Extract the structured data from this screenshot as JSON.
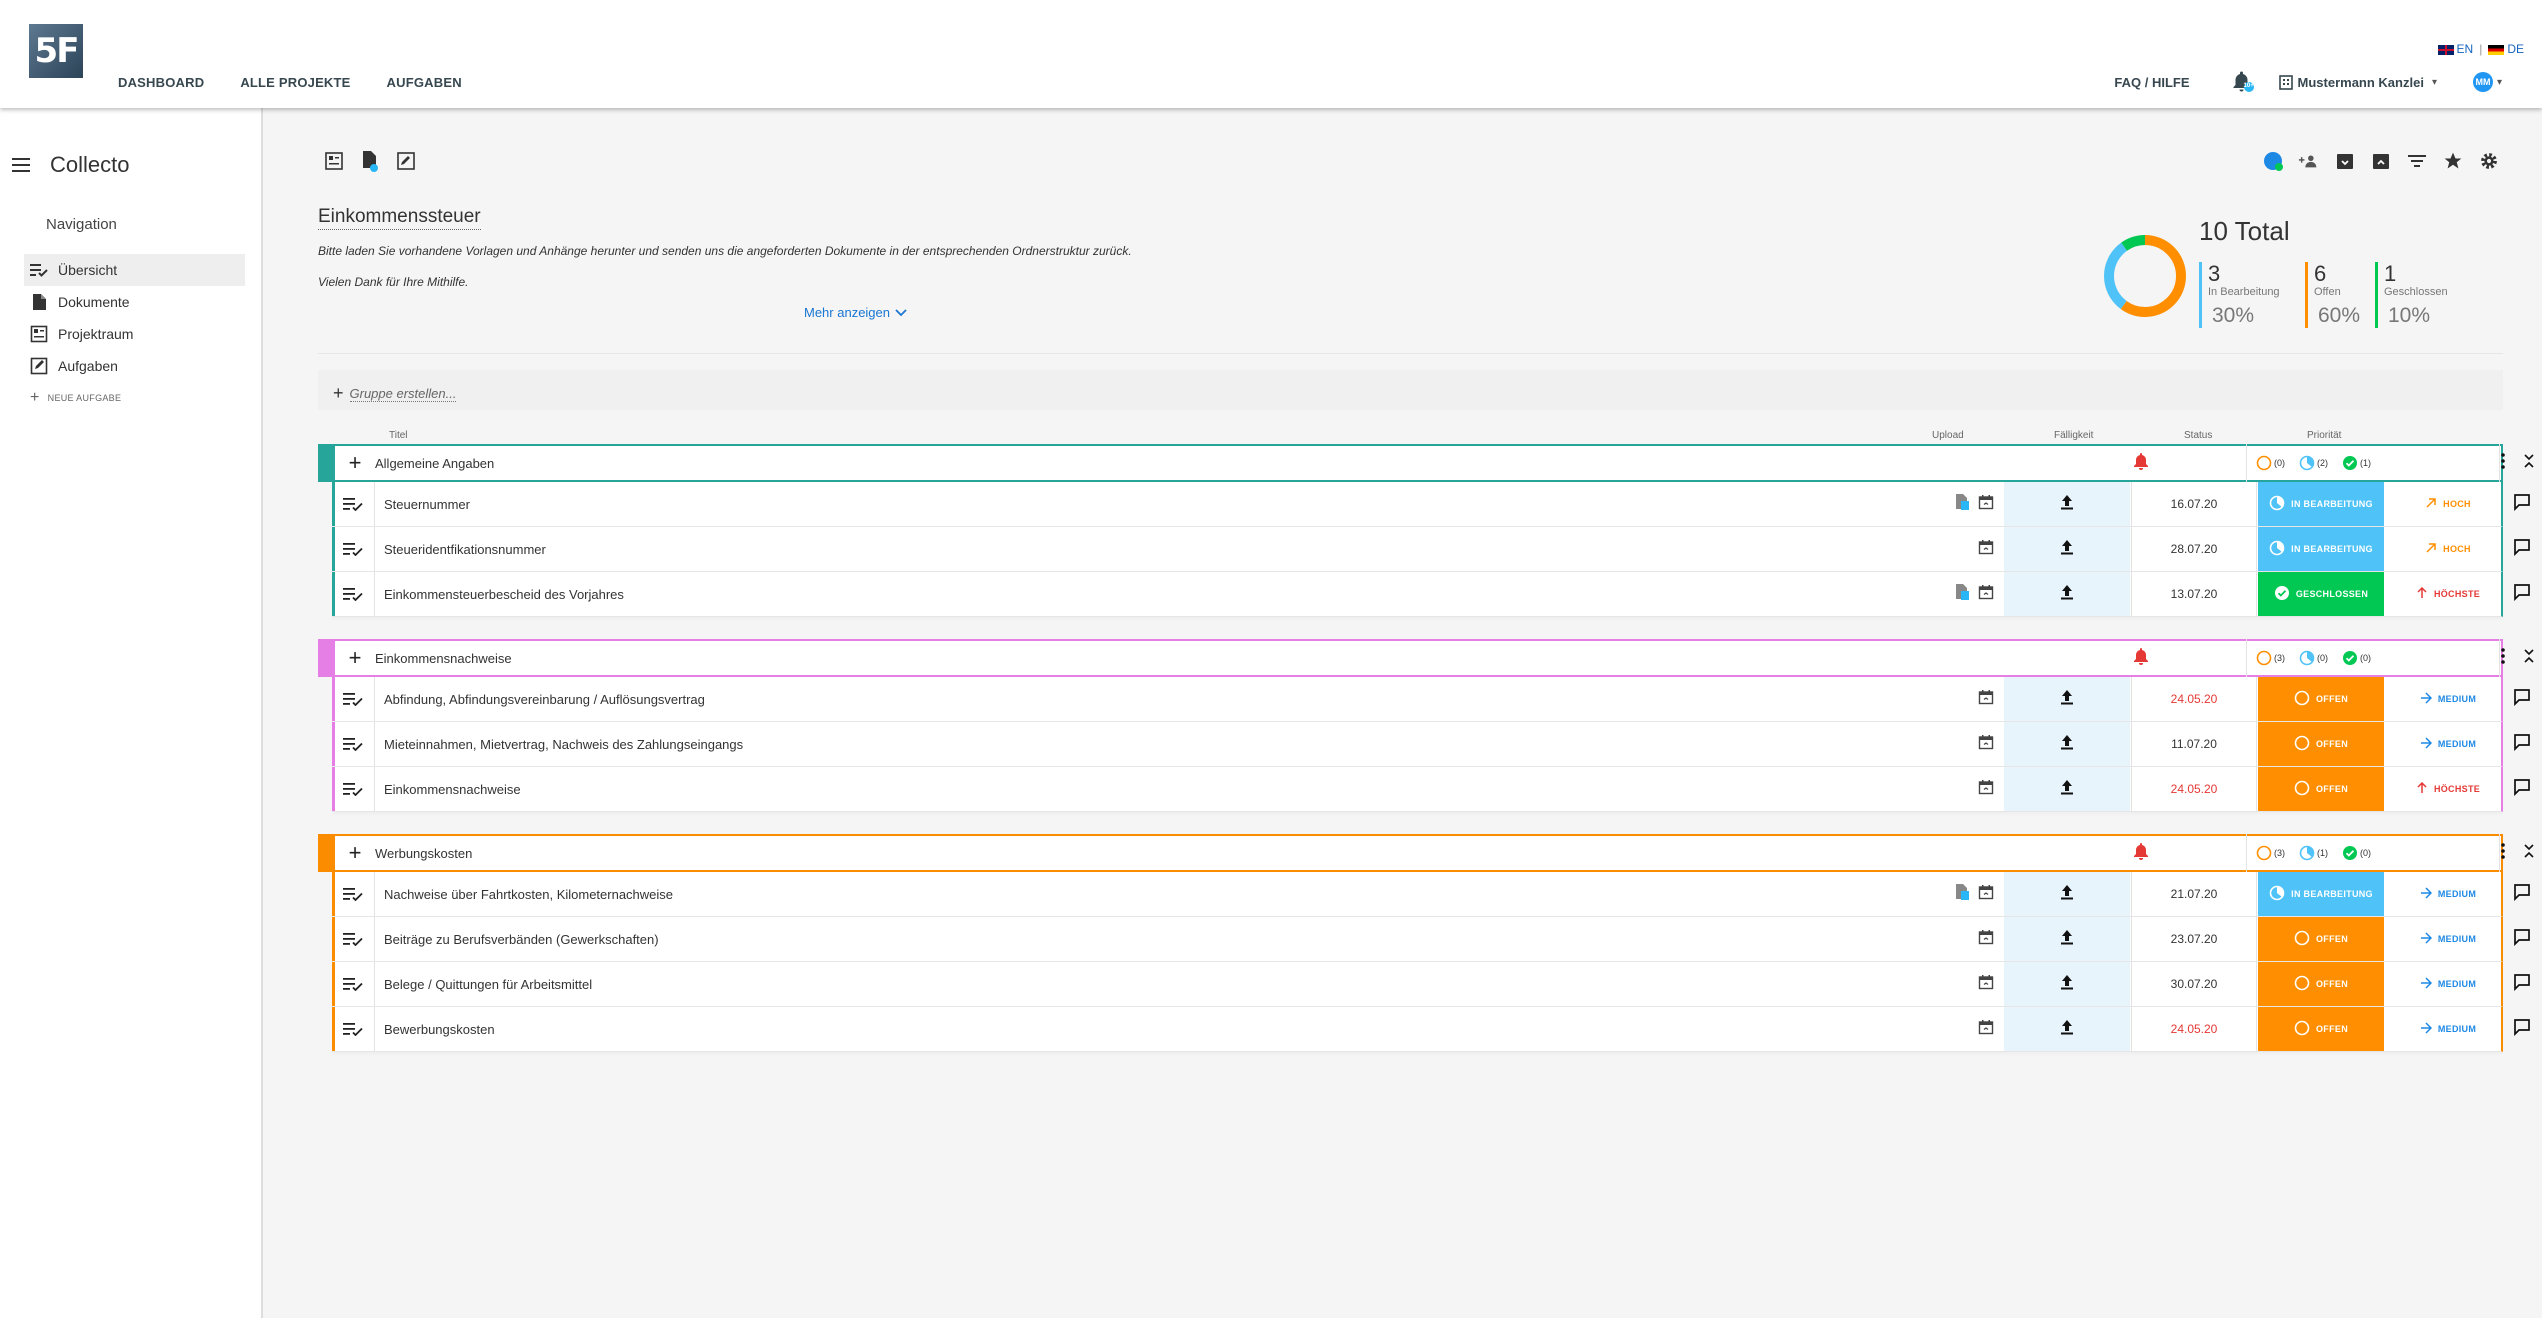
{
  "header": {
    "logo": "5F",
    "nav": [
      "DASHBOARD",
      "ALLE PROJEKTE",
      "AUFGABEN"
    ],
    "lang_en": "EN",
    "lang_de": "DE",
    "faq": "FAQ / HILFE",
    "bell_badge": "10+",
    "org": "Mustermann Kanzlei",
    "avatar": "MM"
  },
  "sidebar": {
    "title": "Collecto",
    "nav_label": "Navigation",
    "items": [
      {
        "label": "Übersicht",
        "icon": "list-check-icon",
        "active": true
      },
      {
        "label": "Dokumente",
        "icon": "document-icon",
        "active": false
      },
      {
        "label": "Projektraum",
        "icon": "projectroom-icon",
        "active": false
      },
      {
        "label": "Aufgaben",
        "icon": "task-edit-icon",
        "active": false
      }
    ],
    "new_task": "NEUE AUFGABE"
  },
  "project": {
    "title": "Einkommenssteuer",
    "description": "Bitte laden Sie vorhandene Vorlagen und Anhänge herunter und senden uns die angeforderten Dokumente in der entsprechenden Ordnerstruktur zurück.",
    "thanks": "Vielen Dank für Ihre Mithilfe.",
    "more": "Mehr anzeigen",
    "create_group": "Gruppe erstellen..."
  },
  "stats": {
    "total": "10 Total",
    "in_progress": {
      "num": "3",
      "label": "In Bearbeitung",
      "pct": "30%",
      "color": "#4fc3f7",
      "fraction": 0.3
    },
    "open": {
      "num": "6",
      "label": "Offen",
      "pct": "60%",
      "color": "#ff8f00",
      "fraction": 0.6
    },
    "closed": {
      "num": "1",
      "label": "Geschlossen",
      "pct": "10%",
      "color": "#00c853",
      "fraction": 0.1
    }
  },
  "columns": {
    "title": "Titel",
    "upload": "Upload",
    "due": "Fälligkeit",
    "status": "Status",
    "priority": "Priorität"
  },
  "groups": [
    {
      "title": "Allgemeine Angaben",
      "color": "#26a69a",
      "counts": {
        "open": "(0)",
        "progress": "(2)",
        "closed": "(1)"
      },
      "rows": [
        {
          "title": "Steuernummer",
          "doc": true,
          "due": "16.07.20",
          "late": false,
          "status": "IN BEARBEITUNG",
          "status_key": "progress",
          "prio": "HOCH",
          "prio_key": "high"
        },
        {
          "title": "Steueridentfikationsnummer",
          "doc": false,
          "due": "28.07.20",
          "late": false,
          "status": "IN BEARBEITUNG",
          "status_key": "progress",
          "prio": "HOCH",
          "prio_key": "high"
        },
        {
          "title": "Einkommensteuerbescheid des Vorjahres",
          "doc": true,
          "due": "13.07.20",
          "late": false,
          "status": "GESCHLOSSEN",
          "status_key": "closed",
          "prio": "HÖCHSTE",
          "prio_key": "highest"
        }
      ]
    },
    {
      "title": "Einkommensnachweise",
      "color": "#e57ee5",
      "counts": {
        "open": "(3)",
        "progress": "(0)",
        "closed": "(0)"
      },
      "rows": [
        {
          "title": "Abfindung, Abfindungsvereinbarung / Auflösungsvertrag",
          "doc": false,
          "due": "24.05.20",
          "late": true,
          "status": "OFFEN",
          "status_key": "open",
          "prio": "MEDIUM",
          "prio_key": "medium"
        },
        {
          "title": "Mieteinnahmen, Mietvertrag, Nachweis des Zahlungseingangs",
          "doc": false,
          "due": "11.07.20",
          "late": false,
          "status": "OFFEN",
          "status_key": "open",
          "prio": "MEDIUM",
          "prio_key": "medium"
        },
        {
          "title": "Einkommensnachweise",
          "doc": false,
          "due": "24.05.20",
          "late": true,
          "status": "OFFEN",
          "status_key": "open",
          "prio": "HÖCHSTE",
          "prio_key": "highest"
        }
      ]
    },
    {
      "title": "Werbungskosten",
      "color": "#fb8c00",
      "counts": {
        "open": "(3)",
        "progress": "(1)",
        "closed": "(0)"
      },
      "rows": [
        {
          "title": "Nachweise über Fahrtkosten, Kilometernachweise",
          "doc": true,
          "due": "21.07.20",
          "late": false,
          "status": "IN BEARBEITUNG",
          "status_key": "progress",
          "prio": "MEDIUM",
          "prio_key": "medium"
        },
        {
          "title": "Beiträge zu Berufsverbänden (Gewerkschaften)",
          "doc": false,
          "due": "23.07.20",
          "late": false,
          "status": "OFFEN",
          "status_key": "open",
          "prio": "MEDIUM",
          "prio_key": "medium"
        },
        {
          "title": "Belege / Quittungen für Arbeitsmittel",
          "doc": false,
          "due": "30.07.20",
          "late": false,
          "status": "OFFEN",
          "status_key": "open",
          "prio": "MEDIUM",
          "prio_key": "medium"
        },
        {
          "title": "Bewerbungskosten",
          "doc": false,
          "due": "24.05.20",
          "late": true,
          "status": "OFFEN",
          "status_key": "open",
          "prio": "MEDIUM",
          "prio_key": "medium"
        }
      ]
    }
  ]
}
